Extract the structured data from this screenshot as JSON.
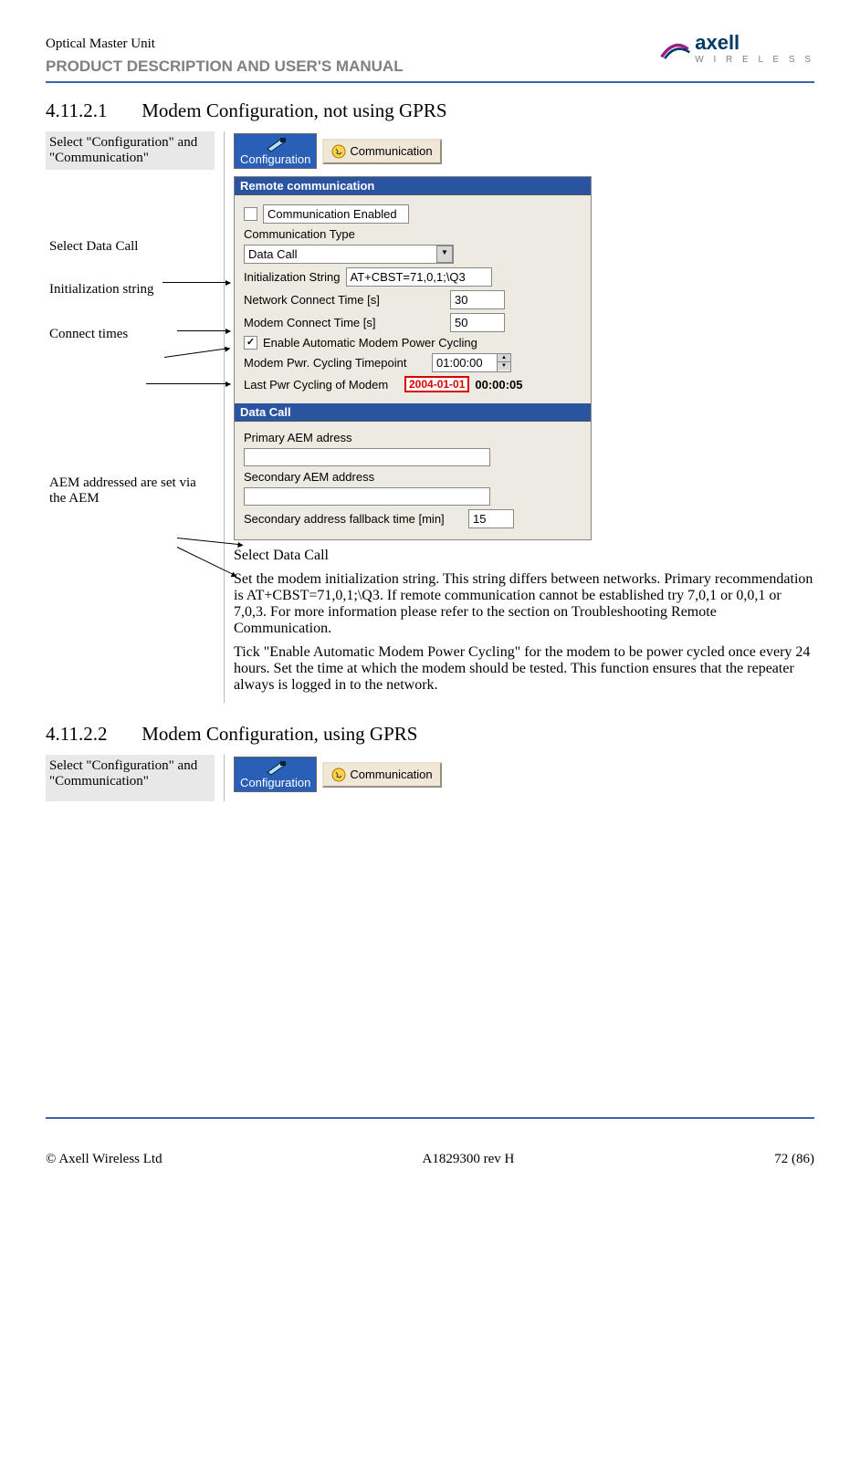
{
  "header": {
    "product": "Optical Master Unit",
    "doctitle": "PRODUCT DESCRIPTION AND USER'S MANUAL",
    "brand_a": "axell",
    "brand_b": "W I R E L E S S"
  },
  "sections": {
    "s1_num": "4.11.2.1",
    "s1_title": "Modem Configuration, not using GPRS",
    "s2_num": "4.11.2.2",
    "s2_title": "Modem Configuration, using GPRS"
  },
  "left": {
    "select_cfg": "Select \"Configuration\" and \"Communication\"",
    "select_datacall": "Select Data Call",
    "init_string": "Initialization string",
    "connect_times": "Connect times",
    "aem_addr": "AEM addressed are set via the AEM",
    "select_cfg2": "Select \"Configuration\" and \"Communication\""
  },
  "icons": {
    "config_label": "Configuration",
    "comm_label": "Communication"
  },
  "dlg": {
    "hdr1": "Remote communication",
    "comm_enabled": "Communication Enabled",
    "comm_type": "Communication Type",
    "comm_type_val": "Data Call",
    "init_label": "Initialization String",
    "init_val": "AT+CBST=71,0,1;\\Q3",
    "nct_label": "Network Connect Time [s]",
    "nct_val": "30",
    "mct_label": "Modem Connect Time [s]",
    "mct_val": "50",
    "auto_cycling": "Enable Automatic Modem Power Cycling",
    "pwr_tp_label": "Modem Pwr. Cycling Timepoint",
    "pwr_tp_val": "01:00:00",
    "last_pwr_label": "Last Pwr Cycling of Modem",
    "last_pwr_date": "2004-01-01",
    "last_pwr_time": "00:00:05",
    "hdr2": "Data Call",
    "prim_aem": "Primary AEM adress",
    "sec_aem": "Secondary AEM address",
    "fallback_label": "Secondary address fallback time [min]",
    "fallback_val": "15"
  },
  "body": {
    "p1": "Select Data Call",
    "p2": "Set the modem initialization string. This string differs between networks. Primary recommendation is AT+CBST=71,0,1;\\Q3. If remote communication cannot be established try 7,0,1 or 0,0,1 or 7,0,3. For more information please refer to the section on Troubleshooting Remote Communication.",
    "p3": "Tick \"Enable Automatic Modem Power Cycling\" for the modem to be power cycled once every 24 hours. Set the time at which the modem should be tested. This function ensures that the repeater always is logged in to the network."
  },
  "footer": {
    "left": "© Axell Wireless Ltd",
    "center": "A1829300 rev H",
    "right": "72 (86)"
  }
}
